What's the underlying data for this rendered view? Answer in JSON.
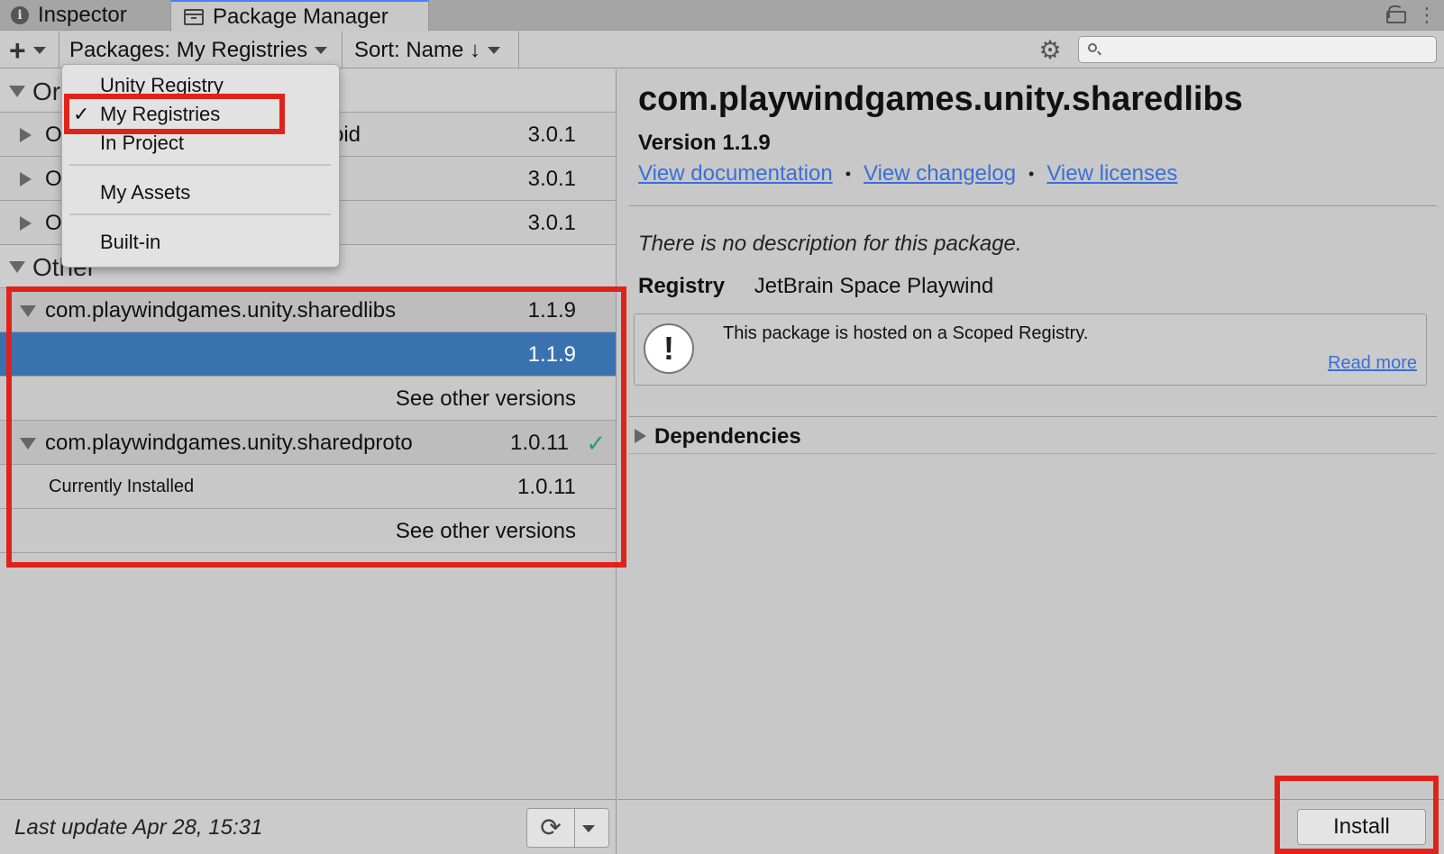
{
  "tabs": {
    "inspector": "Inspector",
    "package_manager": "Package Manager"
  },
  "toolbar": {
    "packages_label": "Packages: My Registries",
    "sort_label": "Sort: Name ↓",
    "search_placeholder": ""
  },
  "dropdown": {
    "items": [
      "Unity Registry",
      "My Registries",
      "In Project",
      "My Assets",
      "Built-in"
    ],
    "checked": "My Registries"
  },
  "left": {
    "group1_label": "Or",
    "group1_rows": [
      {
        "name": "O",
        "name_tail": "oid",
        "version": "3.0.1"
      },
      {
        "name": "O",
        "name_tail": "",
        "version": "3.0.1"
      },
      {
        "name": "O",
        "name_tail": "",
        "version": "3.0.1"
      }
    ],
    "group2_label": "Other",
    "pkg1": {
      "name": "com.playwindgames.unity.sharedlibs",
      "version": "1.1.9",
      "selected_version": "1.1.9",
      "see_other": "See other versions"
    },
    "pkg2": {
      "name": "com.playwindgames.unity.sharedproto",
      "version": "1.0.11",
      "installed_label": "Currently Installed",
      "installed_version": "1.0.11",
      "see_other": "See other versions"
    },
    "last_update": "Last update Apr 28, 15:31"
  },
  "details": {
    "title": "com.playwindgames.unity.sharedlibs",
    "version": "Version 1.1.9",
    "link_docs": "View documentation",
    "link_changelog": "View changelog",
    "link_licenses": "View licenses",
    "description": "There is no description for this package.",
    "registry_key": "Registry",
    "registry_value": "JetBrain Space Playwind",
    "notice_text": "This package is hosted on a Scoped Registry.",
    "notice_link": "Read more",
    "dependencies": "Dependencies",
    "install": "Install"
  },
  "colors": {
    "selection": "#3a72b0",
    "link": "#3a6fd9",
    "annotation": "#e0231a",
    "installed_check": "#2a9d6b"
  }
}
